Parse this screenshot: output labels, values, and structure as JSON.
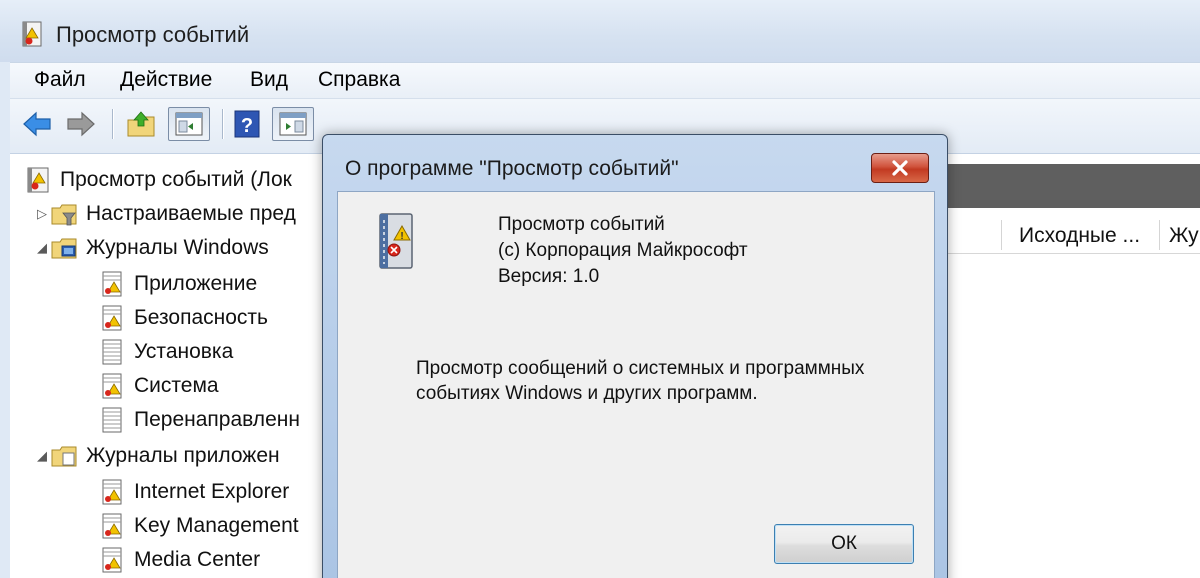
{
  "window": {
    "title": "Просмотр событий"
  },
  "menu": {
    "file": "Файл",
    "action": "Действие",
    "view": "Вид",
    "help": "Справка"
  },
  "toolbar": {
    "icons": [
      "back-arrow-icon",
      "forward-arrow-icon",
      "folder-up-icon",
      "show-hide-tree-icon",
      "help-icon",
      "show-hide-action-pane-icon"
    ]
  },
  "tree": {
    "root": "Просмотр событий (Лок",
    "custom_views": "Настраиваемые пред",
    "windows_logs": "Журналы Windows",
    "windows_logs_items": [
      "Приложение",
      "Безопасность",
      "Установка",
      "Система",
      "Перенаправленн"
    ],
    "app_logs": "Журналы приложен",
    "app_logs_items": [
      "Internet Explorer",
      "Key Management",
      "Media Center"
    ]
  },
  "right_pane": {
    "columns": [
      "Исходные ...",
      "Жу"
    ]
  },
  "dialog": {
    "title": "О программе \"Просмотр событий\"",
    "product": "Просмотр событий",
    "copyright": "(c) Корпорация Майкрософт",
    "version": "Версия: 1.0",
    "description": "Просмотр сообщений о системных и программных событиях Windows и других программ.",
    "ok_label": "ОК"
  },
  "colors": {
    "titlebar": "#d6e2f1",
    "dialog_frame": "#b9cfea",
    "close_button": "#c94a32",
    "dark_strip": "#5f5f5f"
  }
}
